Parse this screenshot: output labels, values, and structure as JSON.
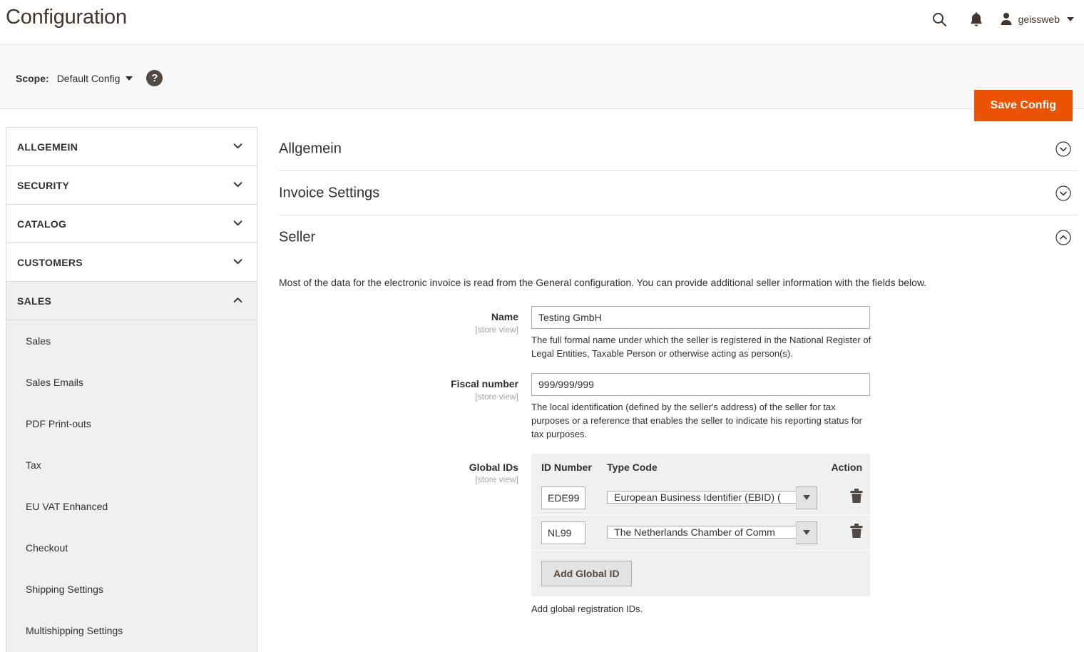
{
  "header": {
    "title": "Configuration",
    "search_icon": "search-icon",
    "notifications_icon": "bell-icon",
    "avatar_icon": "user-avatar-icon",
    "username": "geissweb"
  },
  "scopebar": {
    "scope_label": "Scope:",
    "scope_value": "Default Config",
    "help_glyph": "?",
    "save_label": "Save Config",
    "accent_color": "#eb5202"
  },
  "sidebar": {
    "sections": [
      {
        "label": "ALLGEMEIN",
        "expanded": false,
        "active": false
      },
      {
        "label": "SECURITY",
        "expanded": false,
        "active": false
      },
      {
        "label": "CATALOG",
        "expanded": false,
        "active": false
      },
      {
        "label": "CUSTOMERS",
        "expanded": false,
        "active": false
      },
      {
        "label": "SALES",
        "expanded": true,
        "active": true
      }
    ],
    "sales_items": [
      {
        "label": "Sales"
      },
      {
        "label": "Sales Emails"
      },
      {
        "label": "PDF Print-outs"
      },
      {
        "label": "Tax"
      },
      {
        "label": "EU VAT Enhanced"
      },
      {
        "label": "Checkout"
      },
      {
        "label": "Shipping Settings"
      },
      {
        "label": "Multishipping Settings"
      }
    ]
  },
  "main": {
    "sections": [
      {
        "title": "Allgemein",
        "expanded": false
      },
      {
        "title": "Invoice Settings",
        "expanded": false
      },
      {
        "title": "Seller",
        "expanded": true
      }
    ],
    "seller": {
      "description": "Most of the data for the electronic invoice is read from the General configuration. You can provide additional seller information with the fields below.",
      "scope_note": "[store view]",
      "fields": [
        {
          "label": "Name",
          "scope": "[store view]",
          "value": "Testing GmbH",
          "placeholder": "",
          "note": "The full formal name under which the seller is registered in the National Register of Legal Entities, Taxable Person or otherwise acting as person(s)."
        },
        {
          "label": "Fiscal number",
          "scope": "[store view]",
          "value": "999/999/999",
          "placeholder": "",
          "note": "The local identification (defined by the seller's address) of the seller for tax purposes or a reference that enables the seller to indicate his reporting status for tax purposes."
        }
      ],
      "global_ids": {
        "label": "Global IDs",
        "scope": "[store view]",
        "columns": [
          "ID Number",
          "Type Code",
          "Action"
        ],
        "rows": [
          {
            "id_number": "EDE99",
            "type_code": "European Business Identifier (EBID) (",
            "delete_icon": "trash-icon"
          },
          {
            "id_number": "NL99",
            "type_code": "The Netherlands Chamber of Comm",
            "delete_icon": "trash-icon"
          }
        ],
        "add_label": "Add Global ID",
        "note": "Add global registration IDs."
      }
    }
  }
}
